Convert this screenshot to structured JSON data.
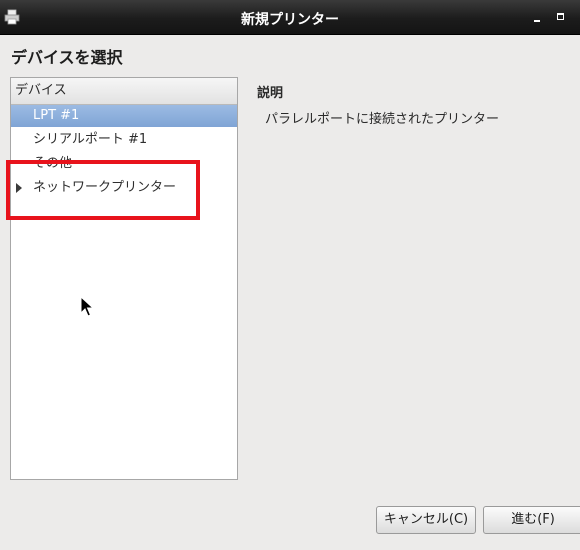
{
  "window": {
    "title": "新規プリンター",
    "app_icon": "printer-icon",
    "minimize_icon": "minimize-icon",
    "maximize_icon": "maximize-icon"
  },
  "heading": "デバイスを選択",
  "device_list": {
    "header": "デバイス",
    "items": [
      {
        "label": "LPT #1",
        "selected": true
      },
      {
        "label": "シリアルポート #1",
        "selected": false
      },
      {
        "label": "その他",
        "selected": false
      },
      {
        "label": "ネットワークプリンター",
        "selected": false,
        "expander": "triangle-right-icon"
      }
    ]
  },
  "description": {
    "title": "説明",
    "text": "パラレルポートに接続されたプリンター"
  },
  "buttons": {
    "cancel": "キャンセル(C)",
    "forward": "進む(F)"
  },
  "colors": {
    "selection": "#86a9d8",
    "annotation_box": "#e8131c",
    "titlebar": "#1c1c1c",
    "background": "#ecebea"
  }
}
